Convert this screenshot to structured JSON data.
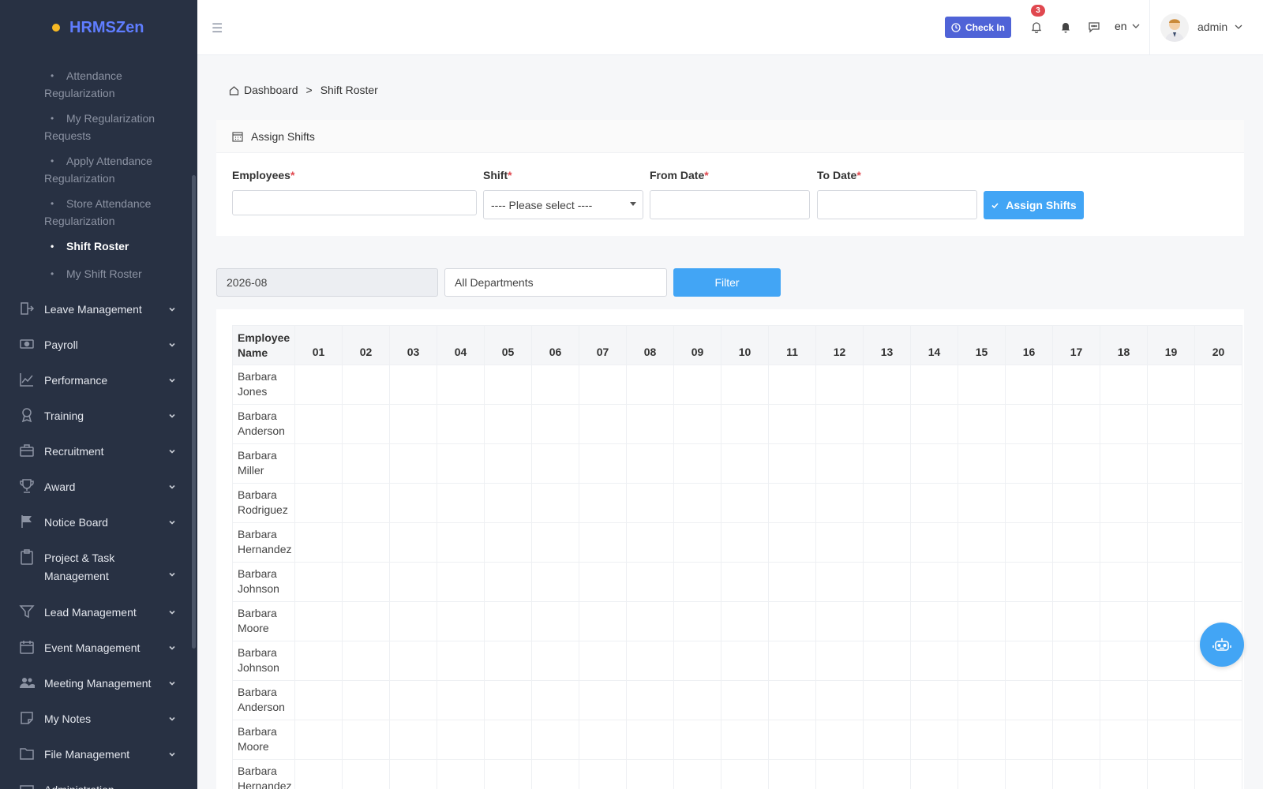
{
  "app": {
    "logo_text": "HRMSZen"
  },
  "sidebar": {
    "sub_items": [
      {
        "label": "Attendance Regularization",
        "active": false
      },
      {
        "label": "My Regularization Requests",
        "active": false
      },
      {
        "label": "Apply Attendance Regularization",
        "active": false
      },
      {
        "label": "Store Attendance Regularization",
        "active": false
      },
      {
        "label": "Shift Roster",
        "active": true
      },
      {
        "label": "My Shift Roster",
        "active": false
      }
    ],
    "items": [
      {
        "label": "Leave Management",
        "icon": "leave-icon"
      },
      {
        "label": "Payroll",
        "icon": "payroll-icon"
      },
      {
        "label": "Performance",
        "icon": "chart-icon"
      },
      {
        "label": "Training",
        "icon": "medal-icon"
      },
      {
        "label": "Recruitment",
        "icon": "briefcase-icon"
      },
      {
        "label": "Award",
        "icon": "trophy-icon"
      },
      {
        "label": "Notice Board",
        "icon": "flag-icon"
      },
      {
        "label": "Project & Task Management",
        "icon": "clipboard-icon"
      },
      {
        "label": "Lead Management",
        "icon": "funnel-icon"
      },
      {
        "label": "Event Management",
        "icon": "calendar-icon"
      },
      {
        "label": "Meeting Management",
        "icon": "users-icon"
      },
      {
        "label": "My Notes",
        "icon": "note-icon"
      },
      {
        "label": "File Management",
        "icon": "folder-icon"
      },
      {
        "label": "Administration",
        "icon": "admin-icon"
      }
    ]
  },
  "header": {
    "checkin_label": "Check In",
    "notification_count": "3",
    "language": "en",
    "user_name": "admin"
  },
  "breadcrumb": {
    "home": "Dashboard",
    "separator": ">",
    "current": "Shift Roster"
  },
  "assign": {
    "title": "Assign Shifts",
    "employees_label": "Employees",
    "shift_label": "Shift",
    "shift_placeholder": "---- Please select ----",
    "from_label": "From Date",
    "to_label": "To Date",
    "required_mark": "*",
    "button_label": "Assign Shifts"
  },
  "filter": {
    "month": "2026-08",
    "department": "All Departments",
    "button_label": "Filter"
  },
  "roster": {
    "employee_header": "Employee Name",
    "days": [
      "01",
      "02",
      "03",
      "04",
      "05",
      "06",
      "07",
      "08",
      "09",
      "10",
      "11",
      "12",
      "13",
      "14",
      "15",
      "16",
      "17",
      "18",
      "19",
      "20"
    ],
    "employees": [
      "Barbara Jones",
      "Barbara Anderson",
      "Barbara Miller",
      "Barbara Rodriguez",
      "Barbara Hernandez",
      "Barbara Johnson",
      "Barbara Moore",
      "Barbara Johnson",
      "Barbara Anderson",
      "Barbara Moore",
      "Barbara Hernandez"
    ]
  },
  "colors": {
    "sidebar_bg": "#283143",
    "accent": "#42a5f5",
    "checkin": "#4f63d7",
    "logo": "#5f7dff"
  }
}
